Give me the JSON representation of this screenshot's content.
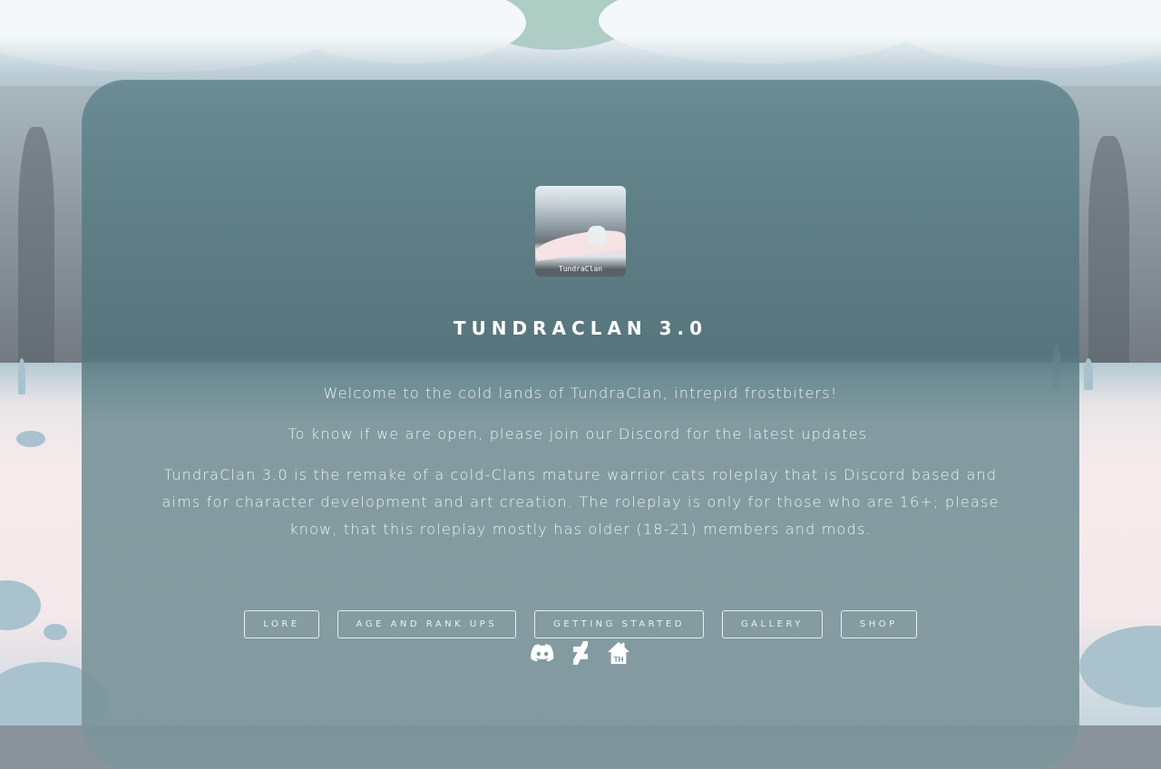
{
  "site": {
    "logo_text": "TundraClan",
    "title": "TUNDRACLAN 3.0"
  },
  "intro": {
    "welcome": "Welcome to the cold lands of TundraClan, intrepid frostbiters!",
    "open_notice": "To know if we are open, please join our Discord for the latest updates.",
    "description": "TundraClan 3.0 is the remake of a cold-Clans mature warrior cats roleplay that is Discord based and aims for character development and art creation. The roleplay is only for those who are 16+; please know, that this roleplay mostly has older (18-21) members and mods."
  },
  "nav": {
    "buttons": [
      {
        "label": "LORE"
      },
      {
        "label": "AGE AND RANK UPS"
      },
      {
        "label": "GETTING STARTED"
      },
      {
        "label": "GALLERY"
      },
      {
        "label": "SHOP"
      }
    ]
  },
  "social": {
    "icons": [
      {
        "name": "discord-icon",
        "label": "Discord"
      },
      {
        "name": "deviantart-icon",
        "label": "DeviantArt"
      },
      {
        "name": "toyhouse-icon",
        "label": "TH"
      }
    ]
  },
  "colors": {
    "panel": "#5f848b",
    "text": "#ffffff",
    "button_border": "#e6eef0"
  }
}
